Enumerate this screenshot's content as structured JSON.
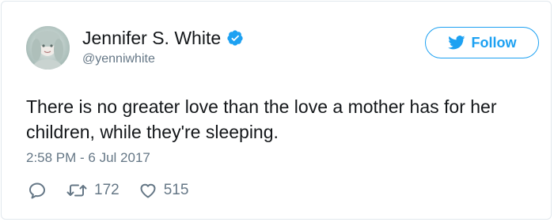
{
  "tweet": {
    "author": {
      "display_name": "Jennifer S. White",
      "handle": "@yenniwhite",
      "verified": true
    },
    "follow_label": "Follow",
    "text": "There is no greater love than the love a mother has for her children, while they're sleeping.",
    "timestamp": "2:58 PM - 6 Jul 2017",
    "retweet_count": "172",
    "like_count": "515"
  },
  "colors": {
    "accent": "#1da1f2",
    "secondary_text": "#657786",
    "primary_text": "#14171a",
    "border": "#e1e8ed"
  },
  "icons": {
    "verified": "verified-badge-icon",
    "follow": "twitter-bird-icon",
    "reply": "reply-icon",
    "retweet": "retweet-icon",
    "like": "heart-icon"
  }
}
